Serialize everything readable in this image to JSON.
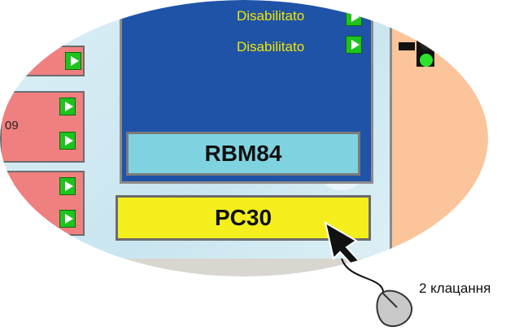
{
  "side_label": "09",
  "disabled_label_1": "Disabilitato",
  "disabled_label_2": "Disabilitato",
  "rbm_label": "RBM84",
  "pc_label": "PC30",
  "caption": "2 клацання",
  "colors": {
    "blue_panel": "#1f53a8",
    "rbm": "#7fd3e0",
    "pc": "#f4ef1c",
    "pink": "#f08080",
    "orange": "#fcc49a",
    "play": "#1fc31f"
  },
  "icons": [
    "play-icon",
    "traffic-light-icon",
    "mouse-icon",
    "pointer-arrow-icon"
  ]
}
